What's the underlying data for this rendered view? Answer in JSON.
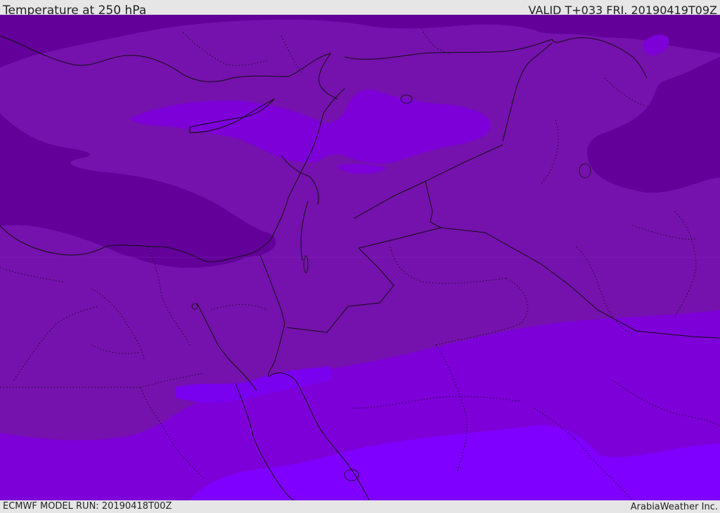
{
  "header": {
    "title": "Temperature at 250 hPa",
    "valid": "VALID T+033 FRI. 20190419T09Z"
  },
  "footer": {
    "model_run": "ECMWF MODEL RUN: 20190418T00Z",
    "credit": "ArabiaWeather Inc."
  },
  "map": {
    "colors": {
      "darkest": "#620099",
      "base": "#7511ad",
      "light": "#7d00d9",
      "lighter": "#7a00f0",
      "lightest": "#7f00ff",
      "border": "#111111"
    }
  }
}
